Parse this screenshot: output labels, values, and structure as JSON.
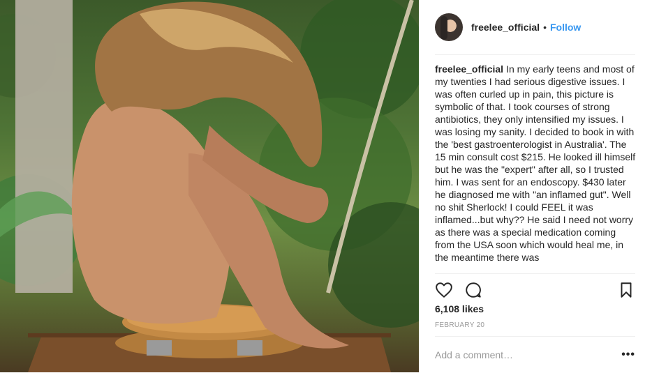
{
  "post": {
    "username": "freelee_official",
    "separator": "•",
    "follow_label": "Follow",
    "caption_username": "freelee_official",
    "caption_text": "In my early teens and most of my twenties I had serious digestive issues. I was often curled up in pain, this picture is symbolic of that. I took courses of strong antibiotics, they only intensified my issues. I was losing my sanity. I decided to book in with the 'best gastroenterologist in Australia'. The 15 min consult cost $215. He looked ill himself but he was the \"expert\" after all, so I trusted him. I was sent for an endoscopy. $430 later he diagnosed me with \"an inflamed gut\". Well no shit Sherlock! I could FEEL it was inflamed...but why?? He said I need not worry as there was a special medication coming from the USA soon which would heal me, in the meantime there was",
    "likes": "6,108 likes",
    "date": "FEBRUARY 20",
    "comment_placeholder": "Add a comment…",
    "more_label": "•••"
  },
  "icons": {
    "like": "heart-outline-icon",
    "comment": "speech-bubble-icon",
    "save": "bookmark-icon"
  },
  "colors": {
    "accent": "#3897f0",
    "text": "#262626",
    "muted": "#999999",
    "border": "#efefef"
  }
}
